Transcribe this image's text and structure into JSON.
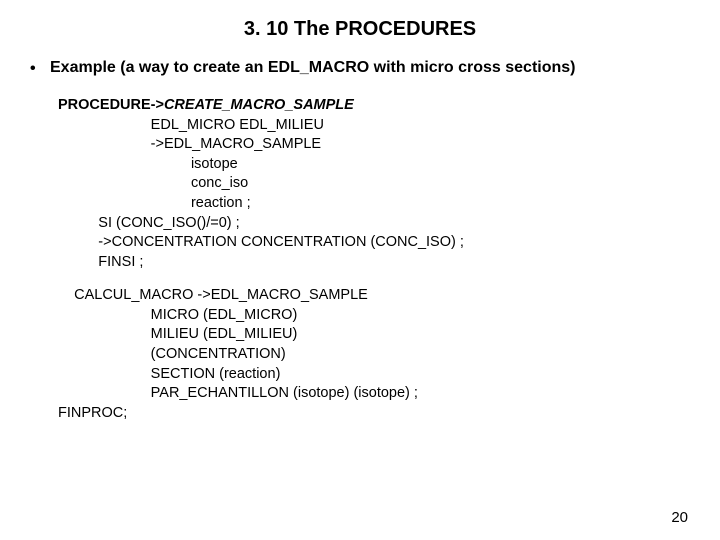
{
  "title": "3. 10 The PROCEDURES",
  "bullet": "Example (a way to create an EDL_MACRO with micro cross sections)",
  "proc": {
    "kw": "PROCEDURE->",
    "name": "CREATE_MACRO_SAMPLE",
    "l1": "EDL_MICRO EDL_MILIEU",
    "l2": "->EDL_MACRO_SAMPLE",
    "l3": "isotope",
    "l4": "conc_iso",
    "l5": "reaction ;",
    "l6": "SI (CONC_ISO()/=0) ;",
    "l7": "->CONCENTRATION CONCENTRATION (CONC_ISO) ;",
    "l8": "FINSI ;"
  },
  "calc": {
    "l0": "CALCUL_MACRO ->EDL_MACRO_SAMPLE",
    "l1": "MICRO (EDL_MICRO)",
    "l2": "MILIEU (EDL_MILIEU)",
    "l3": "(CONCENTRATION)",
    "l4": "SECTION (reaction)",
    "l5": "PAR_ECHANTILLON (isotope) (isotope) ;"
  },
  "finproc": "FINPROC;",
  "pagenum": "20"
}
